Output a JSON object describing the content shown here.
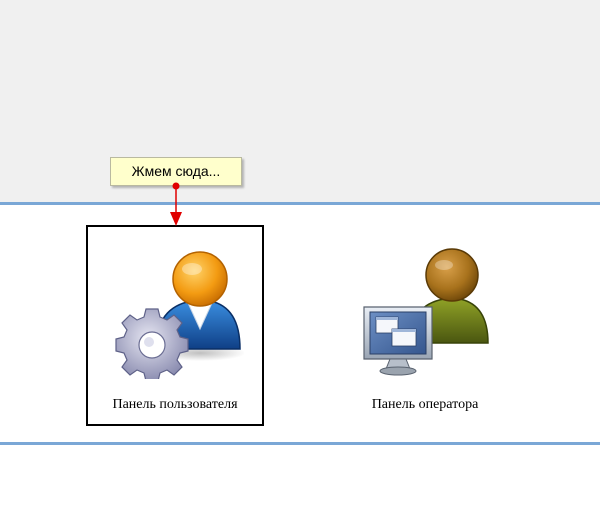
{
  "tooltip": {
    "text": "Жмем сюда..."
  },
  "panels": [
    {
      "label": "Панель пользователя",
      "icon": "user-settings-icon",
      "selected": true
    },
    {
      "label": "Панель оператора",
      "icon": "operator-monitor-icon",
      "selected": false
    }
  ],
  "colors": {
    "divider": "#7aa7d6",
    "tooltip_bg": "#ffffcc",
    "arrow": "#e00000",
    "user_head": "#f39b12",
    "user_body": "#1f64b4",
    "operator_head": "#a8721c",
    "operator_body": "#6f7f1a"
  }
}
